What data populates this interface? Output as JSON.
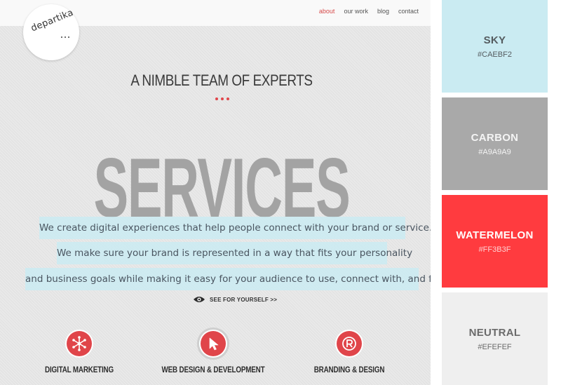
{
  "site": {
    "nav": [
      {
        "label": "about",
        "active": true
      },
      {
        "label": "our work",
        "active": false
      },
      {
        "label": "blog",
        "active": false
      },
      {
        "label": "contact",
        "active": false
      }
    ],
    "logo_text": "departika",
    "headline": "A NIMBLE TEAM OF EXPERTS",
    "big_word": "SERVICES",
    "blurbs": [
      "We create digital experiences that help people connect with your brand or service.",
      "We make sure your brand is represented in a way that fits your personality",
      "and business goals while making it easy for your audience to use, connect with, and find."
    ],
    "cta_label": "SEE FOR YOURSELF >>",
    "services": [
      {
        "label": "DIGITAL MARKETING",
        "icon": "network-icon"
      },
      {
        "label": "WEB DESIGN & DEVELOPMENT",
        "icon": "cursor-icon"
      },
      {
        "label": "BRANDING & DESIGN",
        "icon": "registered-icon"
      }
    ],
    "accent_color": "#e0454a"
  },
  "palette": [
    {
      "name": "SKY",
      "hex": "#CAEBF2"
    },
    {
      "name": "CARBON",
      "hex": "#A9A9A9"
    },
    {
      "name": "WATERMELON",
      "hex": "#FF3B3F"
    },
    {
      "name": "NEUTRAL",
      "hex": "#EFEFEF"
    }
  ]
}
